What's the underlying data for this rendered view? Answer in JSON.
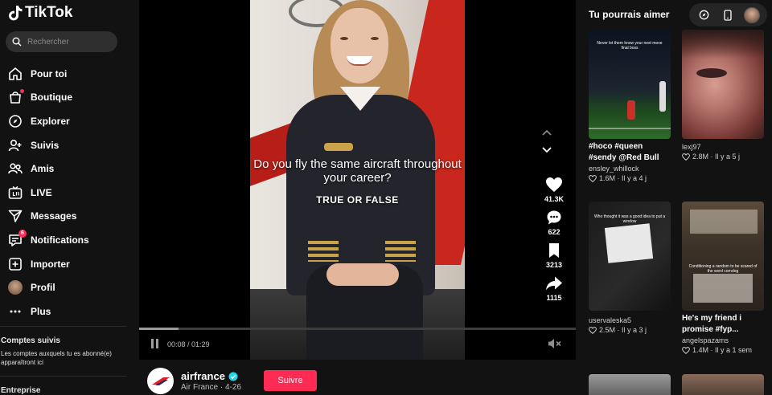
{
  "app": {
    "name": "TikTok"
  },
  "search": {
    "placeholder": "Rechercher"
  },
  "nav": {
    "items": [
      {
        "label": "Pour toi",
        "icon": "home-icon"
      },
      {
        "label": "Boutique",
        "icon": "shop-icon"
      },
      {
        "label": "Explorer",
        "icon": "compass-icon"
      },
      {
        "label": "Suivis",
        "icon": "user-plus-icon"
      },
      {
        "label": "Amis",
        "icon": "friends-icon"
      },
      {
        "label": "LIVE",
        "icon": "live-icon"
      },
      {
        "label": "Messages",
        "icon": "send-icon"
      },
      {
        "label": "Notifications",
        "icon": "inbox-icon",
        "badge": "6"
      },
      {
        "label": "Importer",
        "icon": "plus-square-icon"
      },
      {
        "label": "Profil",
        "icon": "avatar"
      },
      {
        "label": "Plus",
        "icon": "more-icon"
      }
    ]
  },
  "following": {
    "heading": "Comptes suivis",
    "text": "Les comptes auxquels tu es abonné(e) apparaîtront ici"
  },
  "company": {
    "heading": "Entreprise"
  },
  "video": {
    "caption": "Do you fly the same aircraft throughout your career?",
    "subcaption": "TRUE OR FALSE",
    "current_time": "00:08",
    "duration": "01:29",
    "progress": 0.09,
    "time_display": "00:08 / 01:29"
  },
  "actions": {
    "likes": "41.3K",
    "comments": "622",
    "saves": "3213",
    "shares": "1115"
  },
  "author": {
    "handle": "airfrance",
    "verified": true,
    "meta": "Air France · 4-26",
    "follow_label": "Suivre"
  },
  "recommend": {
    "title": "Tu pourrais aimer",
    "cards": [
      {
        "title": "#hoco #queen #sendy @Red Bull",
        "user": "ensley_whillock",
        "stats": "1.6M · Il y a 4 j",
        "thumb_text": "Never let them know your next move final boss"
      },
      {
        "title": "",
        "user": "lexj97",
        "stats": "2.8M · Il y a 5 j",
        "thumb_text": ""
      },
      {
        "title": "",
        "user": "uservaleska5",
        "stats": "2.5M · Il y a 3 j",
        "thumb_text": "Who thought it was a good idea to put a window"
      },
      {
        "title": "He's my friend i promise #fyp...",
        "user": "angelspazams",
        "stats": "1.4M · Il y a 1 sem",
        "thumb_text": "Conditioning a random to be scared of the word corndog"
      }
    ]
  },
  "colors": {
    "accent": "#fe2c55",
    "background": "#121212",
    "player": "#000000"
  }
}
